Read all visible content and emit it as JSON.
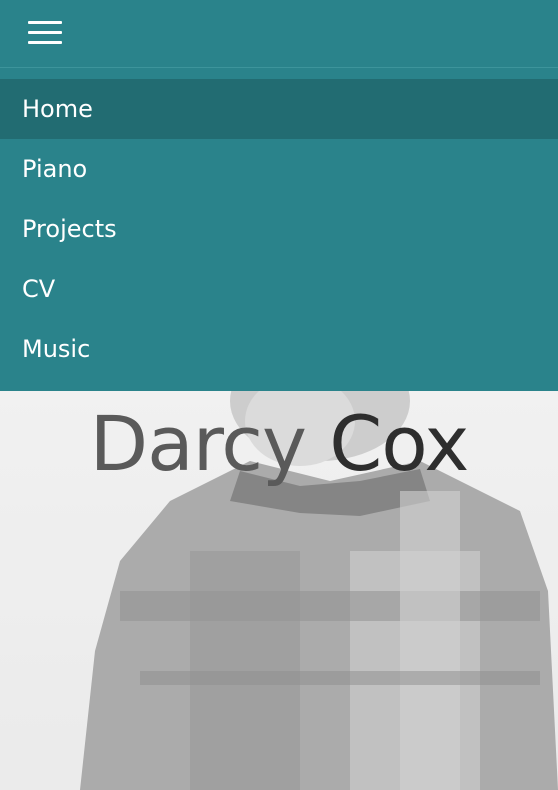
{
  "nav": {
    "menu_icon": "hamburger-menu-icon",
    "items": [
      {
        "label": "Home",
        "active": true
      },
      {
        "label": "Piano",
        "active": false
      },
      {
        "label": "Projects",
        "active": false
      },
      {
        "label": "CV",
        "active": false
      },
      {
        "label": "Music",
        "active": false
      }
    ]
  },
  "hero": {
    "title_first": "Darcy",
    "title_last": "Cox",
    "image": "man-in-plaid-shirt-back-view-photo"
  },
  "colors": {
    "accent": "#2a838b",
    "active_item": "#226c72",
    "text_on_accent": "#ffffff"
  }
}
